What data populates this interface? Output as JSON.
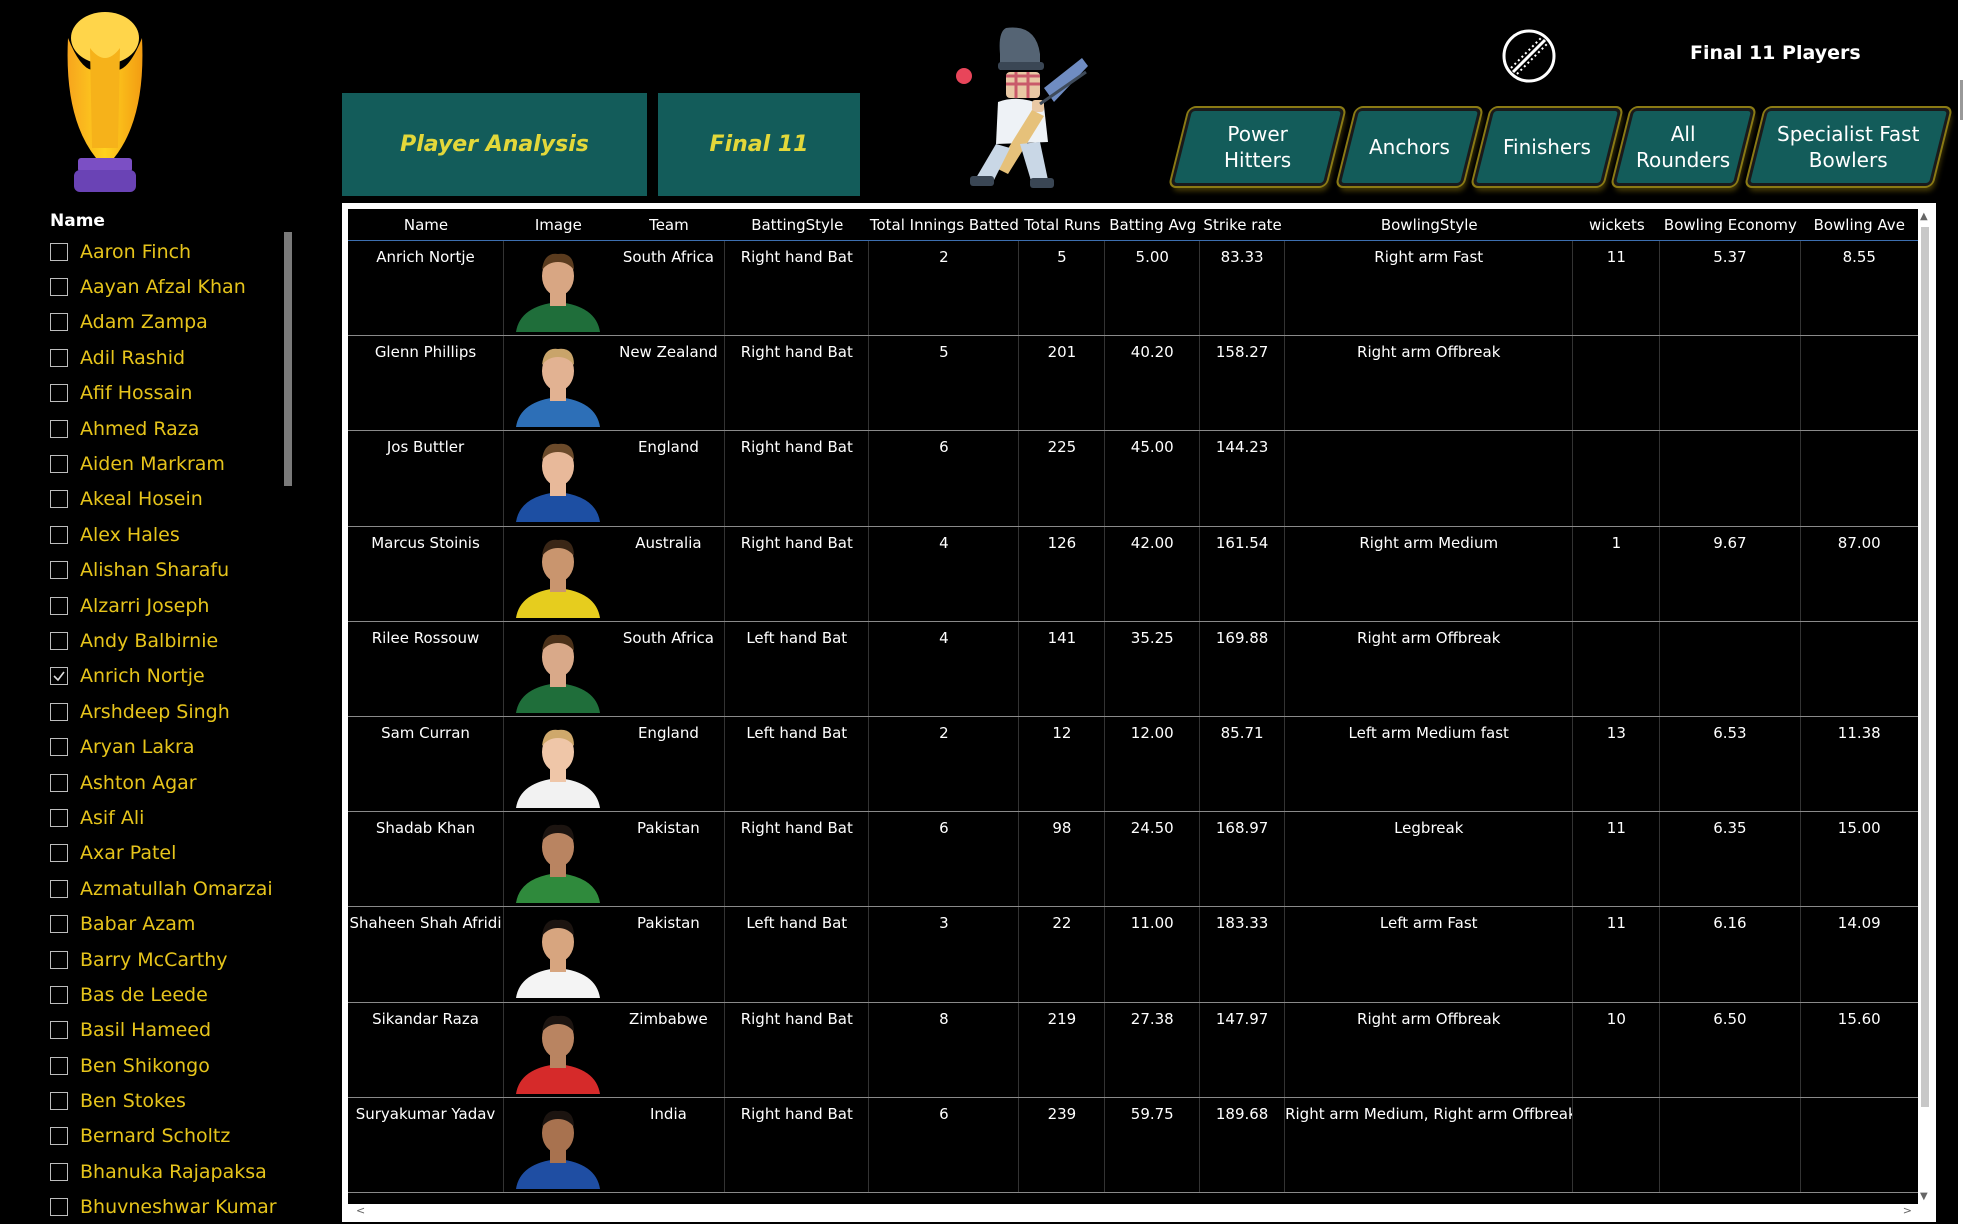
{
  "slicer": {
    "title": "Name",
    "items": [
      {
        "label": "Aaron Finch",
        "checked": false
      },
      {
        "label": "Aayan Afzal Khan",
        "checked": false
      },
      {
        "label": "Adam Zampa",
        "checked": false
      },
      {
        "label": "Adil Rashid",
        "checked": false
      },
      {
        "label": "Afif Hossain",
        "checked": false
      },
      {
        "label": "Ahmed Raza",
        "checked": false
      },
      {
        "label": "Aiden Markram",
        "checked": false
      },
      {
        "label": "Akeal Hosein",
        "checked": false
      },
      {
        "label": "Alex Hales",
        "checked": false
      },
      {
        "label": "Alishan Sharafu",
        "checked": false
      },
      {
        "label": "Alzarri Joseph",
        "checked": false
      },
      {
        "label": "Andy Balbirnie",
        "checked": false
      },
      {
        "label": "Anrich Nortje",
        "checked": true
      },
      {
        "label": "Arshdeep Singh",
        "checked": false
      },
      {
        "label": "Aryan Lakra",
        "checked": false
      },
      {
        "label": "Ashton Agar",
        "checked": false
      },
      {
        "label": "Asif Ali",
        "checked": false
      },
      {
        "label": "Axar Patel",
        "checked": false
      },
      {
        "label": "Azmatullah Omarzai",
        "checked": false
      },
      {
        "label": "Babar Azam",
        "checked": false
      },
      {
        "label": "Barry McCarthy",
        "checked": false
      },
      {
        "label": "Bas de Leede",
        "checked": false
      },
      {
        "label": "Basil Hameed",
        "checked": false
      },
      {
        "label": "Ben Shikongo",
        "checked": false
      },
      {
        "label": "Ben Stokes",
        "checked": false
      },
      {
        "label": "Bernard Scholtz",
        "checked": false
      },
      {
        "label": "Bhanuka Rajapaksa",
        "checked": false
      },
      {
        "label": "Bhuvneshwar Kumar",
        "checked": false
      }
    ]
  },
  "nav": {
    "player_analysis": "Player Analysis",
    "final11": "Final 11"
  },
  "header": {
    "title": "Final 11 Players",
    "trophy_icon": "trophy-icon",
    "batsman_icon": "batsman-icon",
    "ball_icon": "cricket-ball-icon"
  },
  "categories": {
    "power": "Power\nHitters",
    "anchors": "Anchors",
    "finishers": "Finishers",
    "allround": "All\nRounders",
    "fast": "Specialist Fast\nBowlers"
  },
  "colors": {
    "accent_teal": "#135c5a",
    "slicer_text": "#e6c41b",
    "nav_text": "#e3d83a"
  },
  "table": {
    "columns": [
      "Name",
      "Image",
      "Team",
      "BattingStyle",
      "Total Innings Batted",
      "Total Runs",
      "Batting Avg",
      "Strike rate",
      "BowlingStyle",
      "wickets",
      "Bowling Economy",
      "Bowling Ave"
    ],
    "rows": [
      {
        "name": "Anrich Nortje",
        "team": "South Africa",
        "batting_style": "Right hand Bat",
        "innings": "2",
        "runs": "5",
        "bat_avg": "5.00",
        "strike_rate": "83.33",
        "bowling_style": "Right arm Fast",
        "wickets": "11",
        "economy": "5.37",
        "bowl_avg": "8.55",
        "jersey": "#1f6e3a",
        "skin": "#d8a683",
        "hair": "#5a3b1e"
      },
      {
        "name": "Glenn Phillips",
        "team": "New Zealand",
        "batting_style": "Right hand Bat",
        "innings": "5",
        "runs": "201",
        "bat_avg": "40.20",
        "strike_rate": "158.27",
        "bowling_style": "Right arm Offbreak",
        "wickets": "",
        "economy": "",
        "bowl_avg": "",
        "jersey": "#2d6fb7",
        "skin": "#e2b292",
        "hair": "#c9a46a"
      },
      {
        "name": "Jos Buttler",
        "team": "England",
        "batting_style": "Right hand Bat",
        "innings": "6",
        "runs": "225",
        "bat_avg": "45.00",
        "strike_rate": "144.23",
        "bowling_style": "",
        "wickets": "",
        "economy": "",
        "bowl_avg": "",
        "jersey": "#1d4fa3",
        "skin": "#e8b99a",
        "hair": "#6b4a2a"
      },
      {
        "name": "Marcus Stoinis",
        "team": "Australia",
        "batting_style": "Right hand Bat",
        "innings": "4",
        "runs": "126",
        "bat_avg": "42.00",
        "strike_rate": "161.54",
        "bowling_style": "Right arm Medium",
        "wickets": "1",
        "economy": "9.67",
        "bowl_avg": "87.00",
        "jersey": "#e6cd1e",
        "skin": "#c9956e",
        "hair": "#3a2616"
      },
      {
        "name": "Rilee Rossouw",
        "team": "South Africa",
        "batting_style": "Left hand Bat",
        "innings": "4",
        "runs": "141",
        "bat_avg": "35.25",
        "strike_rate": "169.88",
        "bowling_style": "Right arm Offbreak",
        "wickets": "",
        "economy": "",
        "bowl_avg": "",
        "jersey": "#1f6e3a",
        "skin": "#d9a989",
        "hair": "#4a3018"
      },
      {
        "name": "Sam Curran",
        "team": "England",
        "batting_style": "Left hand Bat",
        "innings": "2",
        "runs": "12",
        "bat_avg": "12.00",
        "strike_rate": "85.71",
        "bowling_style": "Left arm Medium fast",
        "wickets": "13",
        "economy": "6.53",
        "bowl_avg": "11.38",
        "jersey": "#f2f2f2",
        "skin": "#efc6a8",
        "hair": "#cfa86b"
      },
      {
        "name": "Shadab Khan",
        "team": "Pakistan",
        "batting_style": "Right hand Bat",
        "innings": "6",
        "runs": "98",
        "bat_avg": "24.50",
        "strike_rate": "168.97",
        "bowling_style": "Legbreak",
        "wickets": "11",
        "economy": "6.35",
        "bowl_avg": "15.00",
        "jersey": "#2f8a3c",
        "skin": "#b98461",
        "hair": "#1c1410"
      },
      {
        "name": "Shaheen Shah Afridi",
        "team": "Pakistan",
        "batting_style": "Left hand Bat",
        "innings": "3",
        "runs": "22",
        "bat_avg": "11.00",
        "strike_rate": "183.33",
        "bowling_style": "Left arm Fast",
        "wickets": "11",
        "economy": "6.16",
        "bowl_avg": "14.09",
        "jersey": "#f4f4f4",
        "skin": "#d7a57f",
        "hair": "#1c1410"
      },
      {
        "name": "Sikandar Raza",
        "team": "Zimbabwe",
        "batting_style": "Right hand Bat",
        "innings": "8",
        "runs": "219",
        "bat_avg": "27.38",
        "strike_rate": "147.97",
        "bowling_style": "Right arm Offbreak",
        "wickets": "10",
        "economy": "6.50",
        "bowl_avg": "15.60",
        "jersey": "#d62a2a",
        "skin": "#b98461",
        "hair": "#1c1410"
      },
      {
        "name": "Suryakumar Yadav",
        "team": "India",
        "batting_style": "Right hand Bat",
        "innings": "6",
        "runs": "239",
        "bat_avg": "59.75",
        "strike_rate": "189.68",
        "bowling_style": "Right arm Medium, Right arm Offbreak",
        "wickets": "",
        "economy": "",
        "bowl_avg": "",
        "jersey": "#1f4ea3",
        "skin": "#a8724f",
        "hair": "#1c1410"
      }
    ]
  }
}
